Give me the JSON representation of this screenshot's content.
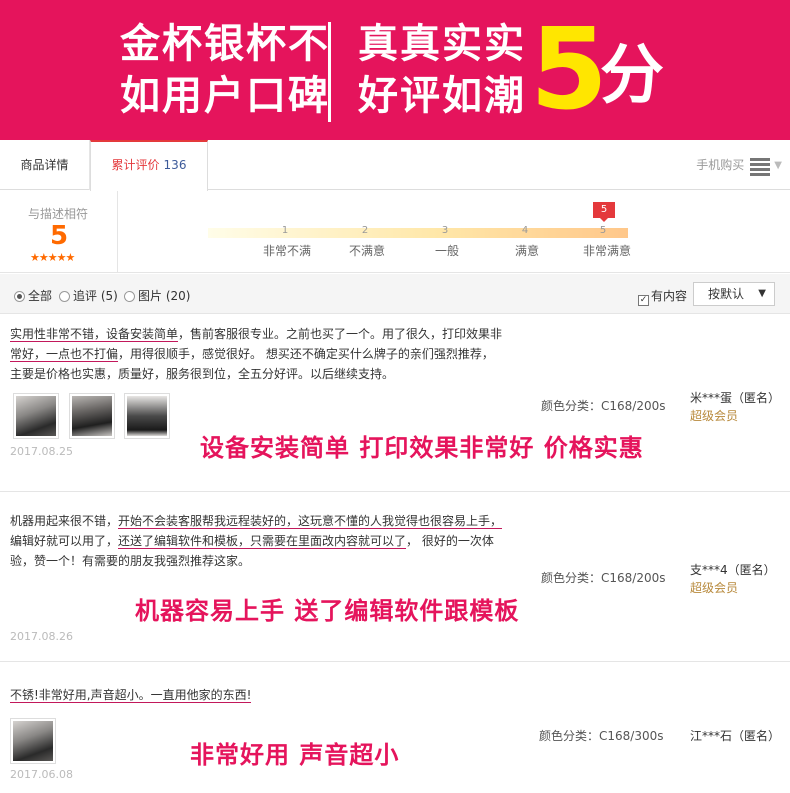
{
  "banner": {
    "left_line1": "金杯银杯不",
    "left_line2": "如用户口碑",
    "mid_line1": "真真实实",
    "mid_line2": "好评如潮",
    "big_number": "5",
    "big_unit": "分",
    "colors": {
      "background": "#e5145c",
      "number": "#ffe600"
    }
  },
  "tabs": {
    "detail_label": "商品详情",
    "review_label": "累计评价",
    "review_count": "136",
    "mobile_buy_label": "手机购买"
  },
  "rating": {
    "label": "与描述相符",
    "score": "5",
    "stars": "★★★★★",
    "marker": "5",
    "ticks": [
      {
        "num": "1",
        "label": "非常不满"
      },
      {
        "num": "2",
        "label": "不满意"
      },
      {
        "num": "3",
        "label": "一般"
      },
      {
        "num": "4",
        "label": "满意"
      },
      {
        "num": "5",
        "label": "非常满意"
      }
    ]
  },
  "filters": {
    "all": "全部",
    "followup": "追评 (5)",
    "images": "图片 (20)",
    "has_content": "有内容",
    "sort_label": "按默认"
  },
  "reviews": [
    {
      "text_a": "实用性非常不错，设备安装简单",
      "text_b": "，售前客服很专业。之前也买了一个。用了很久，打印效果非",
      "text_c": "常好，一点也不打偏",
      "text_d": "，用得很顺手，感觉很好。 想买还不确定买什么牌子的亲们强烈推荐，",
      "text_e": "主要是价格也实惠，质量好，服务很到位，全五分好评。以后继续支持。",
      "spec": "颜色分类：C168/200s",
      "user": "米***蛋（匿名）",
      "level": "超级会员",
      "date": "2017.08.25",
      "highlight": "设备安装简单 打印效果非常好 价格实惠"
    },
    {
      "text_a": "机器用起来很不错，",
      "text_b": "开始不会装客服帮我远程装好的，这玩意不懂的人我觉得也很容易上手，",
      "text_c": "编辑好就可以用了，",
      "text_d": "还送了编辑软件和模板，只需要在里面改内容就可以了",
      "text_e": "， 很好的一次体",
      "text_f": "验，赞一个！有需要的朋友我强烈推荐这家。",
      "spec": "颜色分类：C168/200s",
      "user": "支***4（匿名）",
      "level": "超级会员",
      "date": "2017.08.26",
      "highlight": "机器容易上手 送了编辑软件跟模板"
    },
    {
      "text_a": "不锈!非常好用,声音超小。一直用他家的东西!",
      "spec": "颜色分类：C168/300s",
      "user": "江***石（匿名）",
      "date": "2017.06.08",
      "highlight": "非常好用 声音超小"
    }
  ]
}
